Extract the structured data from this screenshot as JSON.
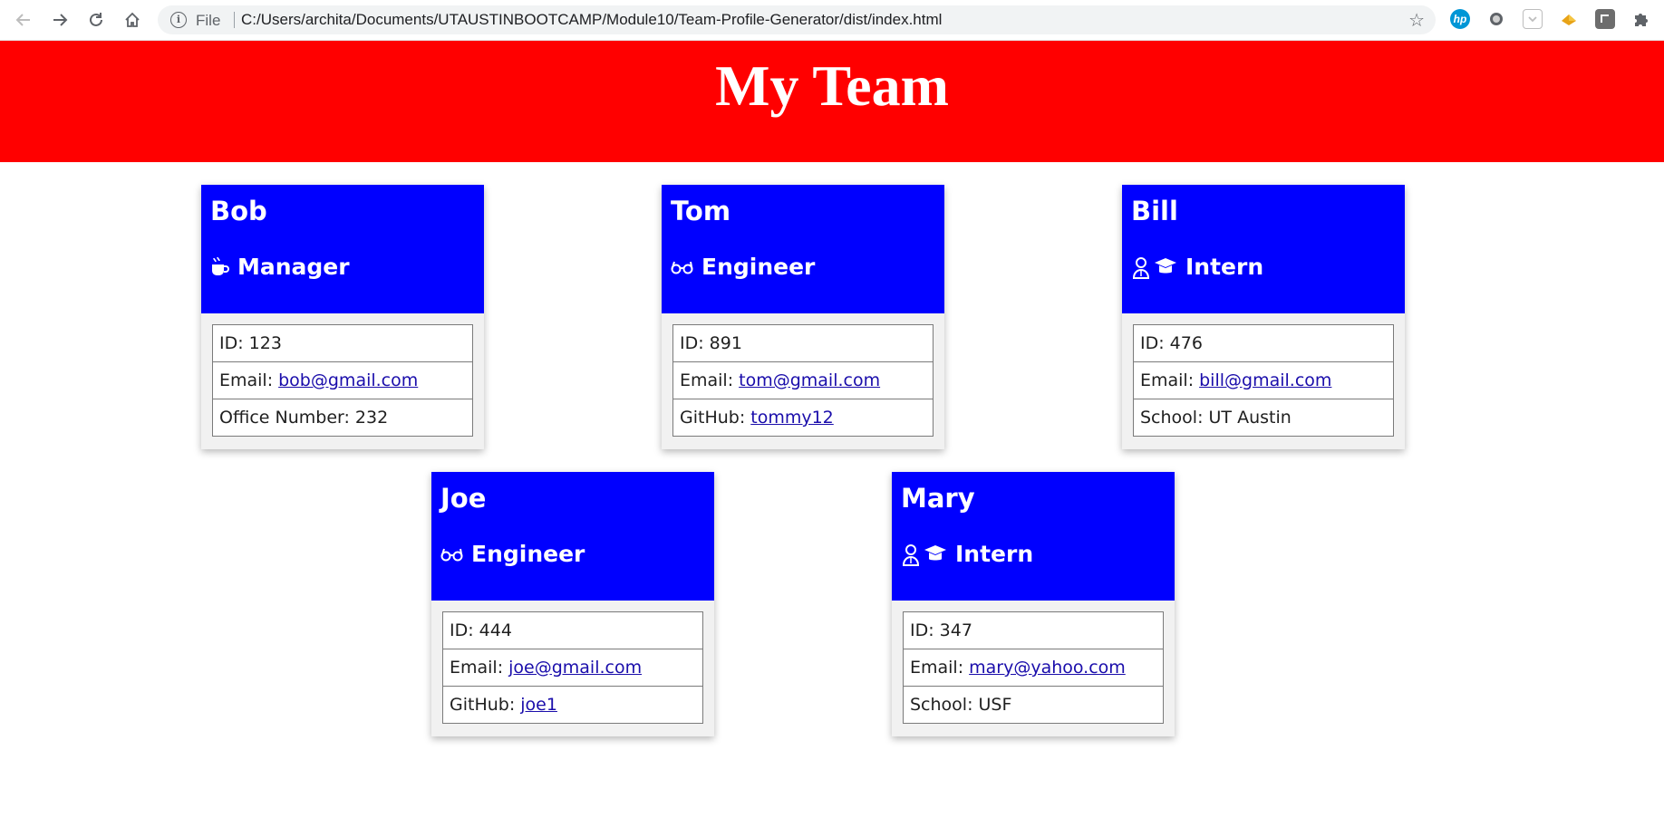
{
  "browser": {
    "file_label": "File",
    "url": "C:/Users/archita/Documents/UTAUSTINBOOTCAMP/Module10/Team-Profile-Generator/dist/index.html",
    "extensions": [
      "hp-icon",
      "record-icon",
      "pocket-icon",
      "extension-diamond-icon",
      "extension-square-icon",
      "puzzle-icon"
    ]
  },
  "page": {
    "title": "My Team",
    "header_color": "#ff0000",
    "card_header_color": "#0000ff"
  },
  "cards": [
    {
      "name": "Bob",
      "role": "Manager",
      "role_icon": "mug-icon",
      "id_label": "ID: 123",
      "email_label": "Email:",
      "email": "bob@gmail.com",
      "extra_label": "Office Number: 232",
      "extra_link": ""
    },
    {
      "name": "Tom",
      "role": "Engineer",
      "role_icon": "glasses-icon",
      "id_label": "ID: 891",
      "email_label": "Email:",
      "email": "tom@gmail.com",
      "extra_label": "GitHub:",
      "extra_link": "tommy12"
    },
    {
      "name": "Bill",
      "role": "Intern",
      "role_icon": "user-graduate-icon",
      "id_label": "ID: 476",
      "email_label": "Email:",
      "email": "bill@gmail.com",
      "extra_label": "School: UT Austin",
      "extra_link": ""
    },
    {
      "name": "Joe",
      "role": "Engineer",
      "role_icon": "glasses-icon",
      "id_label": "ID: 444",
      "email_label": "Email:",
      "email": "joe@gmail.com",
      "extra_label": "GitHub:",
      "extra_link": "joe1"
    },
    {
      "name": "Mary",
      "role": "Intern",
      "role_icon": "user-graduate-icon",
      "id_label": "ID: 347",
      "email_label": "Email:",
      "email": "mary@yahoo.com",
      "extra_label": "School: USF",
      "extra_link": ""
    }
  ]
}
